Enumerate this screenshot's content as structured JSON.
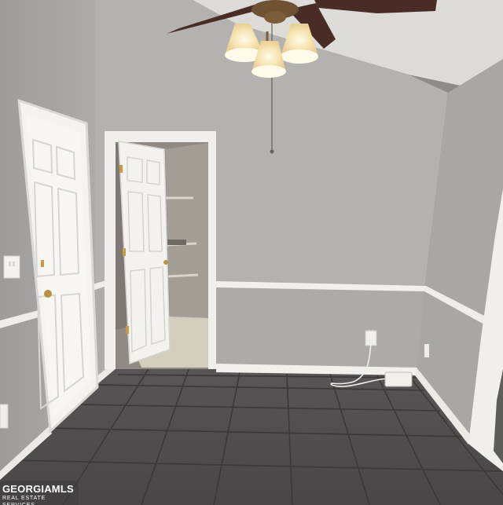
{
  "watermark": {
    "brand": "GEORGIAMLS",
    "tagline": "REAL ESTATE SERVICES"
  },
  "colors": {
    "wall_left": "#a8a7a3",
    "wall_back": "#b1b0ac",
    "wall_right": "#a9a8a4",
    "ceiling": "#d9d8d5",
    "trim": "#f1f0ec",
    "floor": "#4f4b4c",
    "grout": "#3e3a3b",
    "door": "#f3f2ee",
    "light_glow": "#fff6d8"
  }
}
